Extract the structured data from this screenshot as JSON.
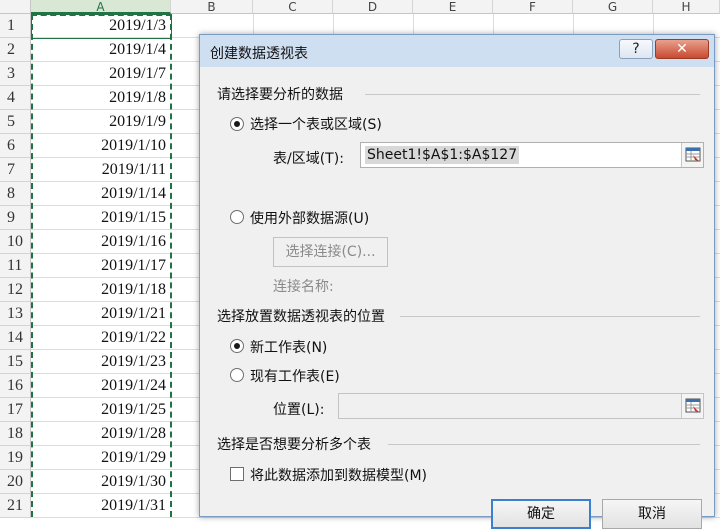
{
  "sheet": {
    "columns": [
      "A",
      "B",
      "C",
      "D",
      "E",
      "F",
      "G",
      "H"
    ],
    "rows": [
      {
        "n": "1",
        "v": "2019/1/3"
      },
      {
        "n": "2",
        "v": "2019/1/4"
      },
      {
        "n": "3",
        "v": "2019/1/7"
      },
      {
        "n": "4",
        "v": "2019/1/8"
      },
      {
        "n": "5",
        "v": "2019/1/9"
      },
      {
        "n": "6",
        "v": "2019/1/10"
      },
      {
        "n": "7",
        "v": "2019/1/11"
      },
      {
        "n": "8",
        "v": "2019/1/14"
      },
      {
        "n": "9",
        "v": "2019/1/15"
      },
      {
        "n": "10",
        "v": "2019/1/16"
      },
      {
        "n": "11",
        "v": "2019/1/17"
      },
      {
        "n": "12",
        "v": "2019/1/18"
      },
      {
        "n": "13",
        "v": "2019/1/21"
      },
      {
        "n": "14",
        "v": "2019/1/22"
      },
      {
        "n": "15",
        "v": "2019/1/23"
      },
      {
        "n": "16",
        "v": "2019/1/24"
      },
      {
        "n": "17",
        "v": "2019/1/25"
      },
      {
        "n": "18",
        "v": "2019/1/28"
      },
      {
        "n": "19",
        "v": "2019/1/29"
      },
      {
        "n": "20",
        "v": "2019/1/30"
      },
      {
        "n": "21",
        "v": "2019/1/31"
      }
    ]
  },
  "dialog": {
    "title": "创建数据透视表",
    "help": "?",
    "close": "✕",
    "section1": "请选择要分析的数据",
    "opt_table": "选择一个表或区域(S)",
    "range_label": "表/区域(T):",
    "range_value": "Sheet1!$A$1:$A$127",
    "opt_external": "使用外部数据源(U)",
    "choose_conn": "选择连接(C)...",
    "conn_name": "连接名称:",
    "section2": "选择放置数据透视表的位置",
    "opt_new": "新工作表(N)",
    "opt_existing": "现有工作表(E)",
    "location_label": "位置(L):",
    "location_value": "",
    "section3": "选择是否想要分析多个表",
    "add_model": "将此数据添加到数据模型(M)",
    "ok": "确定",
    "cancel": "取消"
  },
  "colors": {
    "accent": "#217346",
    "dialog_border": "#7a9cc4",
    "default_button": "#3b7fd1"
  },
  "icons": {
    "range_picker": "range-select-icon"
  }
}
